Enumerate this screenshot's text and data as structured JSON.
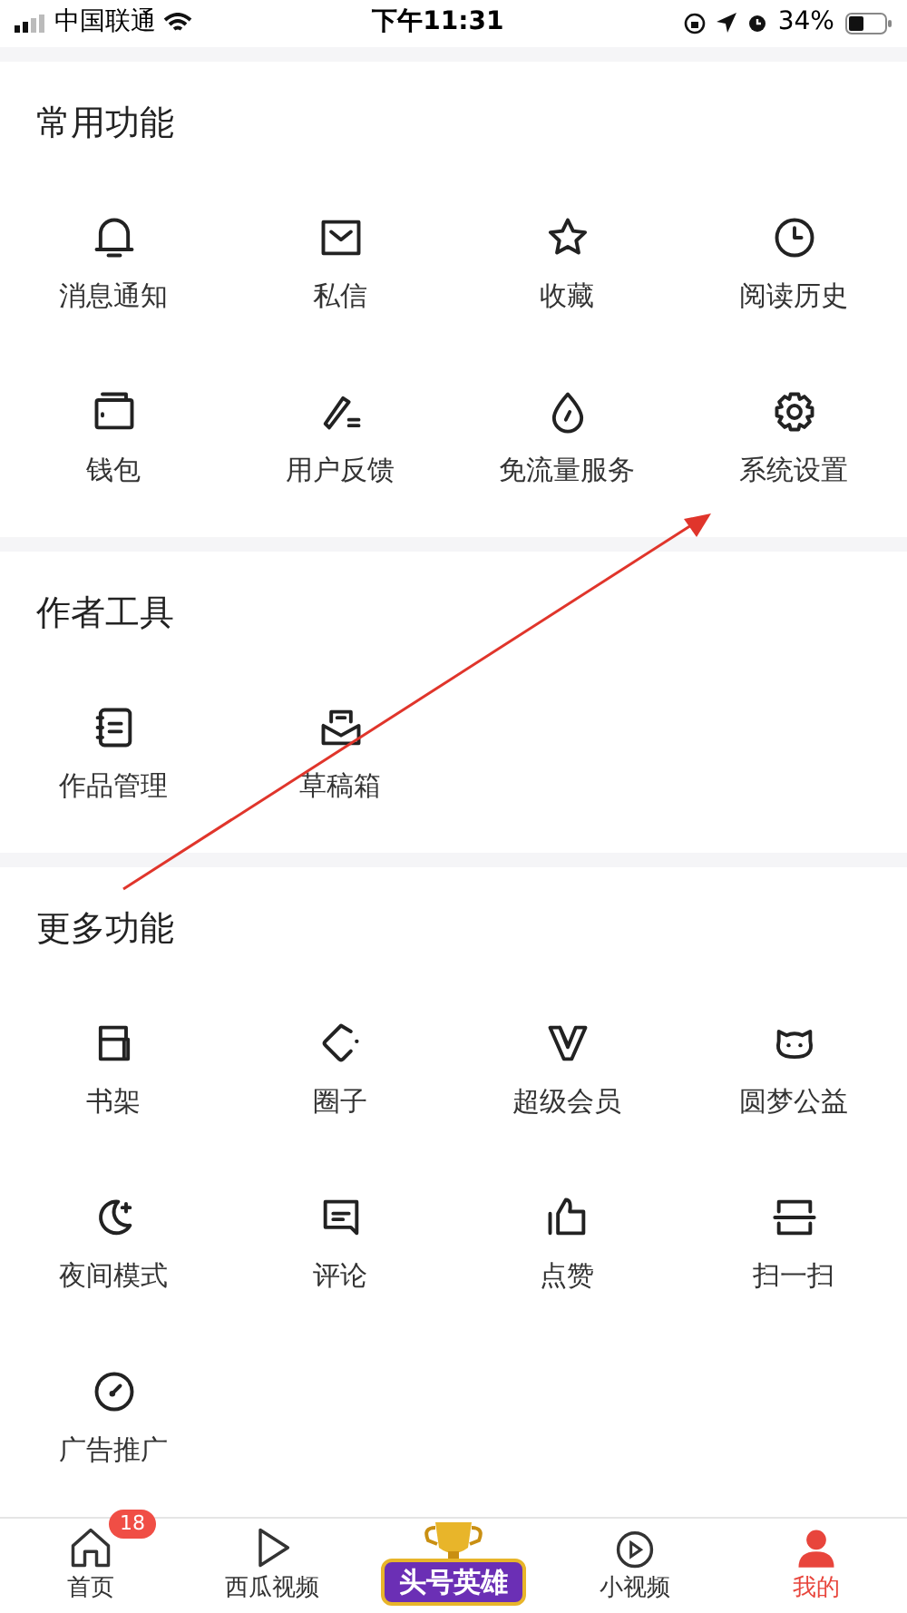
{
  "status_bar": {
    "carrier": "中国联通",
    "time": "下午11:31",
    "battery": "34%"
  },
  "sections": [
    {
      "title": "常用功能",
      "items": [
        "消息通知",
        "私信",
        "收藏",
        "阅读历史",
        "钱包",
        "用户反馈",
        "免流量服务",
        "系统设置"
      ]
    },
    {
      "title": "作者工具",
      "items": [
        "作品管理",
        "草稿箱"
      ]
    },
    {
      "title": "更多功能",
      "items": [
        "书架",
        "圈子",
        "超级会员",
        "圆梦公益",
        "夜间模式",
        "评论",
        "点赞",
        "扫一扫",
        "广告推广"
      ]
    }
  ],
  "tab_bar": [
    {
      "kind": "tab",
      "label": "首页",
      "badge": "18",
      "selected": false
    },
    {
      "kind": "tab",
      "label": "西瓜视频",
      "selected": false
    },
    {
      "kind": "promo",
      "label": "头号英雄"
    },
    {
      "kind": "tab",
      "label": "小视频",
      "selected": false
    },
    {
      "kind": "tab",
      "label": "我的",
      "selected": true
    }
  ]
}
